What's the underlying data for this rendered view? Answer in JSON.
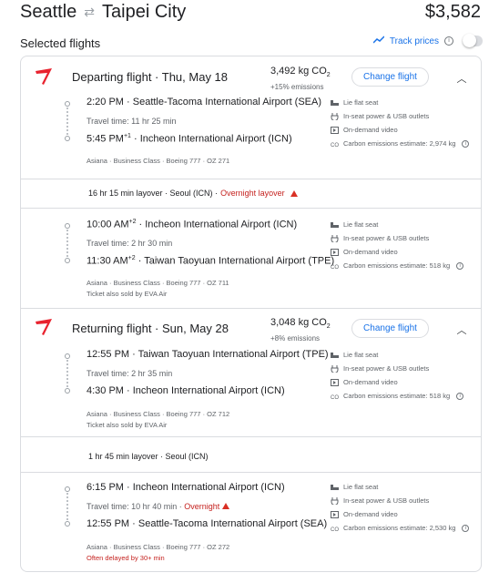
{
  "header": {
    "origin": "Seattle",
    "destination": "Taipei City",
    "price": "$3,582"
  },
  "selected": {
    "title": "Selected flights",
    "track_prices": "Track prices"
  },
  "departing": {
    "title": "Departing flight · Thu, May 18",
    "co2": "3,492 kg CO",
    "co2_sub": "2",
    "emissions": "+15% emissions",
    "change_label": "Change flight",
    "legs": [
      {
        "dep_time": "2:20 PM",
        "dep_airport": "Seattle-Tacoma International Airport (SEA)",
        "travel_time": "Travel time: 11 hr 25 min",
        "arr_time": "5:45 PM",
        "arr_sup": "+1",
        "arr_airport": "Incheon International Airport (ICN)",
        "meta": "Asiana · Business Class · Boeing 777 · OZ 271",
        "meta2": "",
        "amenities": [
          "Lie flat seat",
          "In-seat power & USB outlets",
          "On-demand video",
          "Carbon emissions estimate: 2,974 kg"
        ]
      },
      {
        "dep_time": "10:00 AM",
        "dep_sup": "+2",
        "dep_airport": "Incheon International Airport (ICN)",
        "travel_time": "Travel time: 2 hr 30 min",
        "arr_time": "11:30 AM",
        "arr_sup": "+2",
        "arr_airport": "Taiwan Taoyuan International Airport (TPE)",
        "meta": "Asiana · Business Class · Boeing 777 · OZ 711",
        "meta2": "Ticket also sold by EVA Air",
        "amenities": [
          "Lie flat seat",
          "In-seat power & USB outlets",
          "On-demand video",
          "Carbon emissions estimate: 518 kg"
        ]
      }
    ],
    "layover": "16 hr 15 min layover · Seoul (ICN) · ",
    "layover_warn": "Overnight layover"
  },
  "returning": {
    "title": "Returning flight · Sun, May 28",
    "co2": "3,048 kg CO",
    "co2_sub": "2",
    "emissions": "+8% emissions",
    "change_label": "Change flight",
    "legs": [
      {
        "dep_time": "12:55 PM",
        "dep_airport": "Taiwan Taoyuan International Airport (TPE)",
        "travel_time": "Travel time: 2 hr 35 min",
        "arr_time": "4:30 PM",
        "arr_airport": "Incheon International Airport (ICN)",
        "meta": "Asiana · Business Class · Boeing 777 · OZ 712",
        "meta2": "Ticket also sold by EVA Air",
        "amenities": [
          "Lie flat seat",
          "In-seat power & USB outlets",
          "On-demand video",
          "Carbon emissions estimate: 518 kg"
        ]
      },
      {
        "dep_time": "6:15 PM",
        "dep_airport": "Incheon International Airport (ICN)",
        "travel_time": "Travel time: 10 hr 40 min · ",
        "travel_warn": "Overnight",
        "arr_time": "12:55 PM",
        "arr_airport": "Seattle-Tacoma International Airport (SEA)",
        "meta": "Asiana · Business Class · Boeing 777 · OZ 272",
        "meta2": "Often delayed by 30+ min",
        "amenities": [
          "Lie flat seat",
          "In-seat power & USB outlets",
          "On-demand video",
          "Carbon emissions estimate: 2,530 kg"
        ]
      }
    ],
    "layover": "1 hr 45 min layover · Seoul (ICN)"
  },
  "colors": {
    "accent": "#1a73e8",
    "warning": "#c5221f",
    "logo": "#e8222e"
  }
}
